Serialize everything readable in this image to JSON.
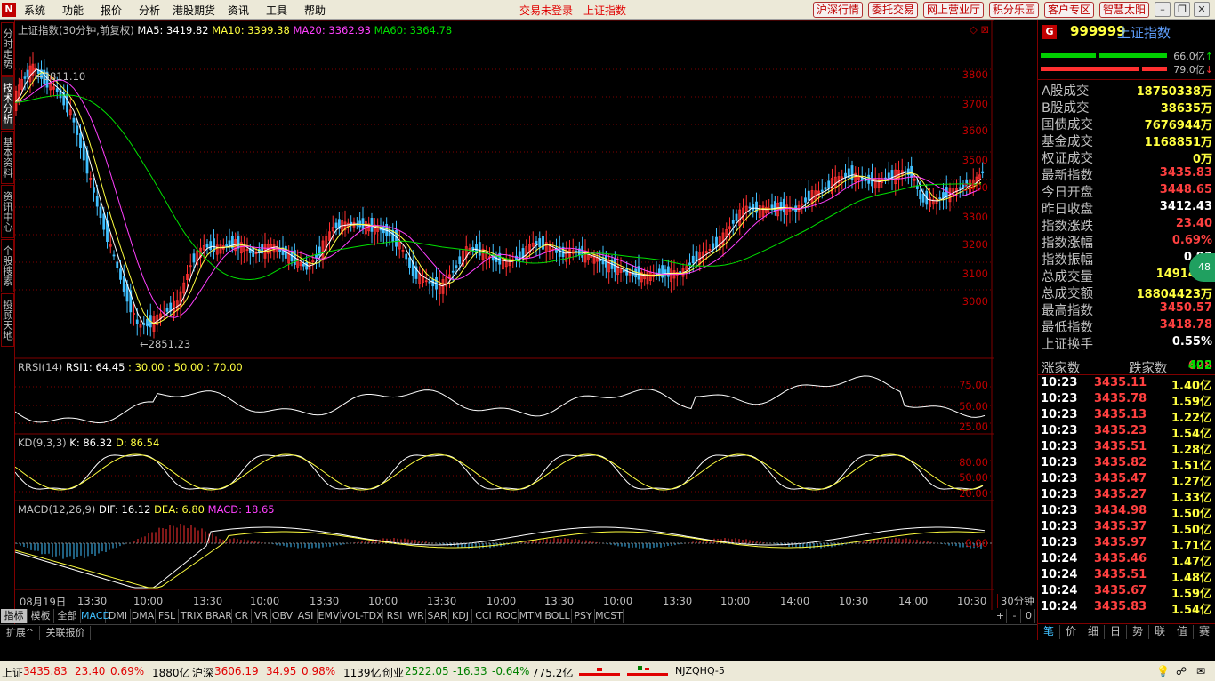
{
  "menu": {
    "items": [
      "系统",
      "功能",
      "报价",
      "分析",
      "港股期货",
      "资讯",
      "工具",
      "帮助"
    ],
    "status1": "交易未登录",
    "status2": "上证指数",
    "buttons": [
      "沪深行情",
      "委托交易",
      "网上营业厅",
      "积分乐园",
      "客户专区",
      "智慧太阳"
    ]
  },
  "left_tabs": [
    "分时走势",
    "技术分析",
    "基本资料",
    "资讯中心",
    "个股搜索",
    "投顾天地"
  ],
  "main": {
    "title": "上证指数(30分钟,前复权)",
    "ma5": "MA5: 3419.82",
    "ma10": "MA10: 3399.38",
    "ma20": "MA20: 3362.93",
    "ma60": "MA60: 3364.78",
    "hi_label": "3811.10",
    "lo_label": "2851.23",
    "y_ticks": [
      "3800",
      "3700",
      "3600",
      "3500",
      "3400",
      "3300",
      "3200",
      "3100",
      "3000"
    ]
  },
  "rsi": {
    "title": "RRSI(14)",
    "rsi1": "RSI1: 64.45",
    "levels": ": 30.00 : 50.00 : 70.00",
    "y_ticks": [
      "75.00",
      "50.00",
      "25.00"
    ]
  },
  "kd": {
    "title": "KD(9,3,3)",
    "k": "K: 86.32",
    "d": "D: 86.54",
    "y_ticks": [
      "80.00",
      "50.00",
      "20.00"
    ]
  },
  "macd": {
    "title": "MACD(12,26,9)",
    "dif": "DIF: 16.12",
    "dea": "DEA: 6.80",
    "macd": "MACD: 18.65",
    "y_ticks": [
      "0.00"
    ]
  },
  "time_axis": {
    "labels": [
      "08月19日",
      "13:30",
      "10:00",
      "13:30",
      "10:00",
      "13:30",
      "10:00",
      "13:30",
      "10:00",
      "13:30",
      "10:00",
      "13:30",
      "10:00",
      "14:00",
      "10:30",
      "14:00",
      "10:30"
    ],
    "period": "30分钟"
  },
  "indicator_tabs": [
    "指标",
    "模板",
    "全部",
    "MACD",
    "DMI",
    "DMA",
    "FSL",
    "TRIX",
    "BRAR",
    "CR",
    "VR",
    "OBV",
    "ASI",
    "EMV",
    "VOL-TDX",
    "RSI",
    "WR",
    "SAR",
    "KDJ",
    "CCI",
    "ROC",
    "MTM",
    "BOLL",
    "PSY",
    "MCST"
  ],
  "zoom_controls": [
    "+",
    "-",
    "0"
  ],
  "extra_tabs": [
    "扩展^",
    "关联报价"
  ],
  "side": {
    "code_badge": "G",
    "code": "999999",
    "name": "上证指数",
    "vol_up": "66.0亿",
    "vol_down": "79.0亿",
    "rows": [
      {
        "label": "A股成交",
        "value": "18750338万"
      },
      {
        "label": "B股成交",
        "value": "38635万"
      },
      {
        "label": "国债成交",
        "value": "7676944万"
      },
      {
        "label": "基金成交",
        "value": "1168851万"
      },
      {
        "label": "权证成交",
        "value": "0万"
      },
      {
        "label": "最新指数",
        "value": "3435.83"
      },
      {
        "label": "今日开盘",
        "value": "3448.65"
      },
      {
        "label": "昨日收盘",
        "value": "3412.43"
      },
      {
        "label": "指数涨跌",
        "value": "23.40"
      },
      {
        "label": "指数涨幅",
        "value": "0.69%"
      },
      {
        "label": "指数振幅",
        "value": "0.93"
      },
      {
        "label": "总成交量",
        "value": "1491481"
      },
      {
        "label": "总成交额",
        "value": "18804423万"
      },
      {
        "label": "最高指数",
        "value": "3450.57"
      },
      {
        "label": "最低指数",
        "value": "3418.78"
      },
      {
        "label": "上证换手",
        "value": "0.55%"
      }
    ],
    "row_colors": [
      "#ffff40",
      "#ffff40",
      "#ffff40",
      "#ffff40",
      "#ffff40",
      "#ff4040",
      "#ff4040",
      "#ffffff",
      "#ff4040",
      "#ff4040",
      "#ffffff",
      "#ffff40",
      "#ffff40",
      "#ff4040",
      "#ff4040",
      "#ffffff"
    ],
    "adv_label": "涨家数",
    "adv": "628",
    "dec_label": "跌家数",
    "dec": "402",
    "badge": "48",
    "ticks": [
      [
        "10:23",
        "3435.11",
        "1.40亿"
      ],
      [
        "10:23",
        "3435.78",
        "1.59亿"
      ],
      [
        "10:23",
        "3435.13",
        "1.22亿"
      ],
      [
        "10:23",
        "3435.23",
        "1.54亿"
      ],
      [
        "10:23",
        "3435.51",
        "1.28亿"
      ],
      [
        "10:23",
        "3435.82",
        "1.51亿"
      ],
      [
        "10:23",
        "3435.47",
        "1.27亿"
      ],
      [
        "10:23",
        "3435.27",
        "1.33亿"
      ],
      [
        "10:23",
        "3434.98",
        "1.50亿"
      ],
      [
        "10:23",
        "3435.37",
        "1.50亿"
      ],
      [
        "10:23",
        "3435.97",
        "1.71亿"
      ],
      [
        "10:24",
        "3435.46",
        "1.47亿"
      ],
      [
        "10:24",
        "3435.51",
        "1.48亿"
      ],
      [
        "10:24",
        "3435.67",
        "1.59亿"
      ],
      [
        "10:24",
        "3435.83",
        "1.54亿"
      ]
    ],
    "bottom_tabs": [
      "笔",
      "价",
      "细",
      "日",
      "势",
      "联",
      "值",
      "赛"
    ]
  },
  "status": {
    "sh_label": "上证",
    "sh_price": "3435.83",
    "sh_chg": "23.40",
    "sh_pct": "0.69%",
    "sh_amt": "1880亿",
    "sz_label": "沪深",
    "sz_price": "3606.19",
    "sz_chg": "34.95",
    "sz_pct": "0.98%",
    "sz_amt": "1139亿",
    "cy_label": "创业",
    "cy_price": "2522.05",
    "cy_chg": "-16.33",
    "cy_pct": "-0.64%",
    "cy_amt": "775.2亿",
    "server": "NJZQHQ-5"
  },
  "colors": {
    "up": "#ff3030",
    "down": "#40c0ff",
    "ma5": "#ffffff",
    "ma10": "#ffff40",
    "ma20": "#ff40ff",
    "ma60": "#00e000",
    "grid": "#800000"
  }
}
